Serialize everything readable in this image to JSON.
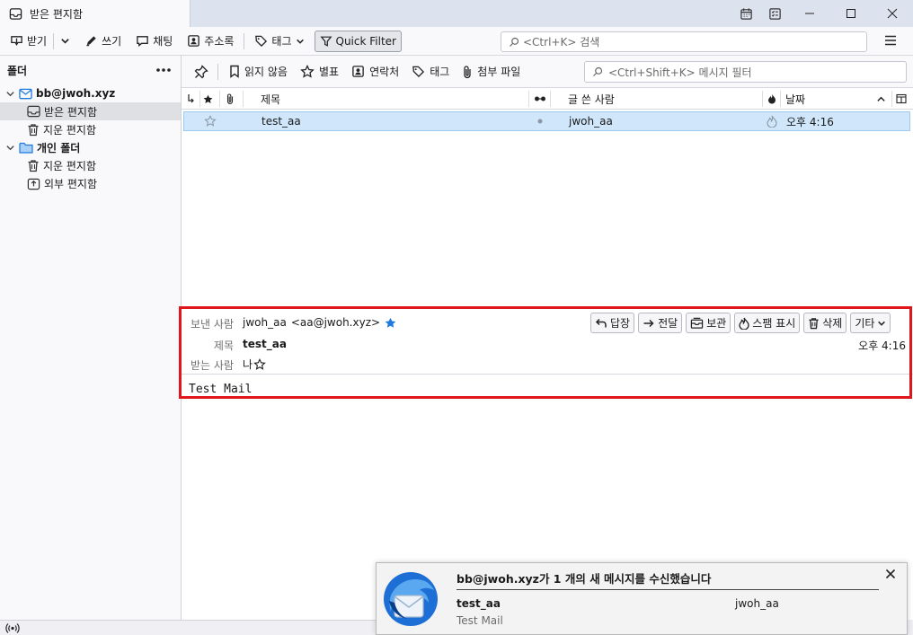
{
  "window": {
    "tab_title": "받은 편지함"
  },
  "toolbar": {
    "get_messages": "받기",
    "write": "쓰기",
    "chat": "채팅",
    "address_book": "주소록",
    "tag": "태그",
    "quick_filter": "Quick Filter",
    "search_placeholder": "<Ctrl+K> 검색"
  },
  "folder_pane": {
    "header": "폴더",
    "account": "bb@jwoh.xyz",
    "inbox": "받은 편지함",
    "trash": "지운 편지함",
    "local_folders": "개인 폴더",
    "local_trash": "지운 편지함",
    "outbox": "외부 편지함"
  },
  "quick_filter_bar": {
    "unread": "읽지 않음",
    "starred": "별표",
    "contact": "연락처",
    "tags": "태그",
    "attachment": "첨부 파일",
    "filter_placeholder": "<Ctrl+Shift+K> 메시지 필터"
  },
  "thread_pane": {
    "columns": {
      "subject": "제목",
      "correspondent": "글 쓴 사람",
      "date": "날짜"
    },
    "rows": [
      {
        "subject": "test_aa",
        "from": "jwoh_aa",
        "date": "오후 4:16"
      }
    ]
  },
  "message": {
    "from_label": "보낸 사람",
    "from_name": "jwoh_aa",
    "from_email": "<aa@jwoh.xyz>",
    "subject_label": "제목",
    "subject": "test_aa",
    "to_label": "받는 사람",
    "to": "나",
    "date": "오후 4:16",
    "body": "Test Mail",
    "actions": {
      "reply": "답장",
      "forward": "전달",
      "archive": "보관",
      "junk": "스팸 표시",
      "delete": "삭제",
      "more": "기타"
    }
  },
  "notification": {
    "title": "bb@jwoh.xyz가 1 개의 새 메시지를 수신했습니다",
    "subject": "test_aa",
    "from": "jwoh_aa",
    "preview": "Test Mail"
  },
  "colors": {
    "accent": "#0060df",
    "selection_bg": "#cfe6fb",
    "highlight_box": "#e0161b",
    "star": "#1f7ae0"
  }
}
